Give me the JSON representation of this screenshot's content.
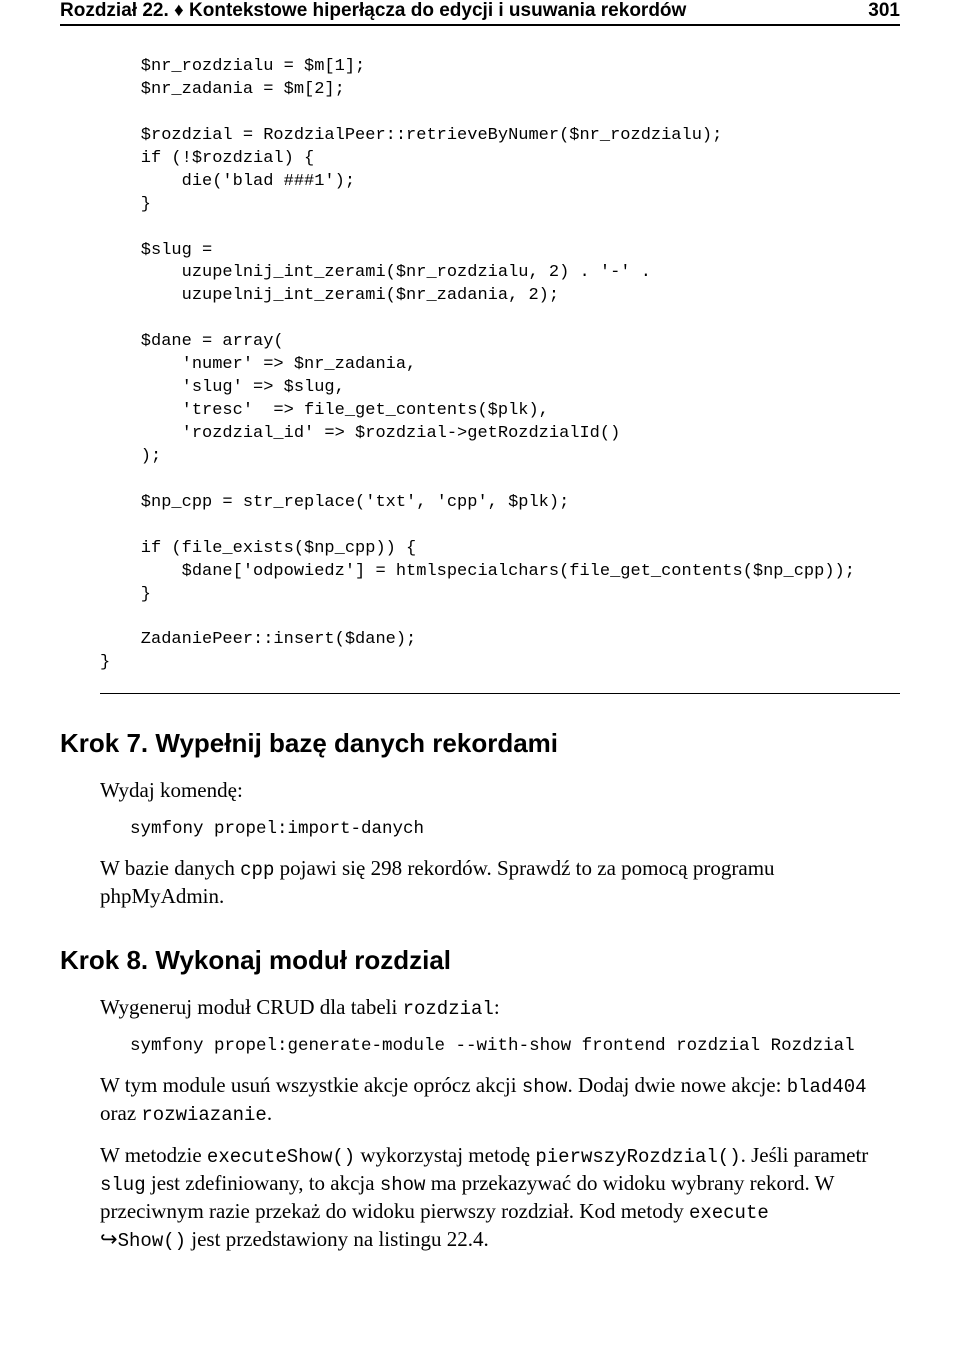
{
  "header": {
    "chapter_label": "Rozdział 22.",
    "diamond": "♦",
    "chapter_title": "Kontekstowe hiperłącza do edycji i usuwania rekordów",
    "page_number": "301"
  },
  "code": {
    "line01": "    $nr_rozdzialu = $m[1];",
    "line02": "    $nr_zadania = $m[2];",
    "blank1": "",
    "line03": "    $rozdzial = RozdzialPeer::retrieveByNumer($nr_rozdzialu);",
    "line04": "    if (!$rozdzial) {",
    "line05": "        die('blad ###1');",
    "line06": "    }",
    "blank2": "",
    "line07": "    $slug =",
    "line08": "        uzupelnij_int_zerami($nr_rozdzialu, 2) . '-' .",
    "line09": "        uzupelnij_int_zerami($nr_zadania, 2);",
    "blank3": "",
    "line10": "    $dane = array(",
    "line11": "        'numer' => $nr_zadania,",
    "line12": "        'slug' => $slug,",
    "line13": "        'tresc'  => file_get_contents($plk),",
    "line14": "        'rozdzial_id' => $rozdzial->getRozdzialId()",
    "line15": "    );",
    "blank4": "",
    "line16": "    $np_cpp = str_replace('txt', 'cpp', $plk);",
    "blank5": "",
    "line17": "    if (file_exists($np_cpp)) {",
    "line18": "        $dane['odpowiedz'] = htmlspecialchars(file_get_contents($np_cpp));",
    "line19": "    }",
    "blank6": "",
    "line20": "    ZadaniePeer::insert($dane);",
    "line21": "}"
  },
  "step7": {
    "heading": "Krok 7. Wypełnij bazę danych rekordami",
    "p1": "Wydaj komendę:",
    "cmd": "symfony propel:import-danych",
    "p2_a": "W bazie danych ",
    "p2_b": "cpp",
    "p2_c": " pojawi się 298 rekordów. Sprawdź to za pomocą programu phpMyAdmin."
  },
  "step8": {
    "heading": "Krok 8. Wykonaj moduł rozdzial",
    "p1_a": "Wygeneruj moduł CRUD dla tabeli ",
    "p1_b": "rozdzial",
    "p1_c": ":",
    "cmd": "symfony propel:generate-module --with-show frontend rozdzial Rozdzial",
    "p2_a": "W tym module usuń wszystkie akcje oprócz akcji ",
    "p2_b": "show",
    "p2_c": ". Dodaj dwie nowe akcje: ",
    "p2_d": "blad404",
    "p2_e": " oraz ",
    "p2_f": "rozwiazanie",
    "p2_g": ".",
    "p3_a": "W metodzie ",
    "p3_b": "executeShow()",
    "p3_c": " wykorzystaj metodę ",
    "p3_d": "pierwszyRozdzial()",
    "p3_e": ". Jeśli parametr ",
    "p3_f": "slug",
    "p3_g": " jest zdefiniowany, to akcja ",
    "p3_h": "show",
    "p3_i": " ma przekazywać do widoku wybrany rekord. W przeciwnym razie przekaż do widoku pierwszy rozdział. Kod metody ",
    "p3_j": "execute",
    "p3_arrow": "↪",
    "p3_k": "Show()",
    "p3_l": " jest przedstawiony na listingu 22.4."
  }
}
